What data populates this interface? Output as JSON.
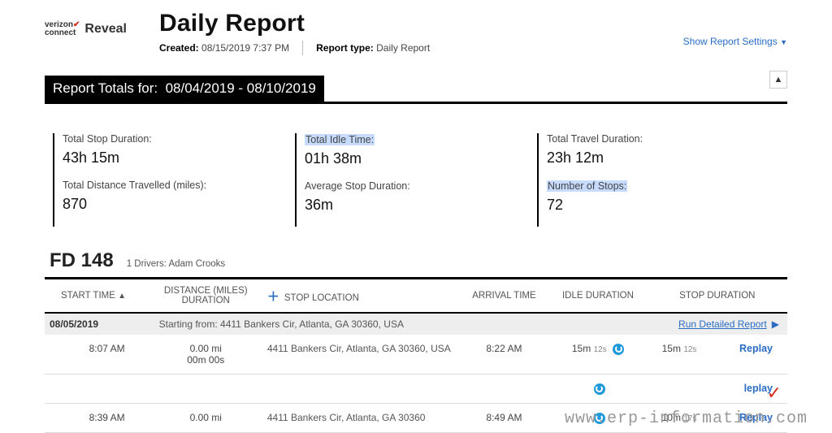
{
  "brand": {
    "line1": "verizon",
    "line2": "connect",
    "name": "Reveal"
  },
  "header": {
    "title": "Daily Report",
    "created_label": "Created:",
    "created_value": "08/15/2019 7:37 PM",
    "type_label": "Report type:",
    "type_value": "Daily Report",
    "settings_link": "Show Report Settings"
  },
  "totals": {
    "prefix": "Report Totals for:",
    "range": "08/04/2019 - 08/10/2019",
    "metrics": {
      "stop_dur_label": "Total Stop Duration:",
      "stop_dur_value": "43h 15m",
      "dist_label": "Total Distance Travelled (miles):",
      "dist_value": "870",
      "idle_label": "Total Idle Time:",
      "idle_value": "01h 38m",
      "avg_stop_label": "Average Stop Duration:",
      "avg_stop_value": "36m",
      "travel_label": "Total Travel Duration:",
      "travel_value": "23h 12m",
      "stops_label": "Number of Stops:",
      "stops_value": "72"
    }
  },
  "vehicle": {
    "name": "FD 148",
    "driver_label": "1 Drivers:",
    "driver_name": "Adam Crooks"
  },
  "columns": {
    "start": "START TIME",
    "dist": "DISTANCE (MILES)\nDURATION",
    "loc": "STOP LOCATION",
    "arrival": "ARRIVAL TIME",
    "idle": "IDLE DURATION",
    "stopdur": "STOP DURATION"
  },
  "day": {
    "date": "08/05/2019",
    "starting_label": "Starting from:",
    "starting_addr": "4411 Bankers Cir, Atlanta, GA 30360, USA",
    "detailed_link": "Run Detailed Report"
  },
  "rows": [
    {
      "start": "8:07 AM",
      "dist": "0.00 mi",
      "dur": "00m 00s",
      "loc": "4411 Bankers Cir, Atlanta, GA 30360, USA",
      "arrival": "8:22 AM",
      "idle_m": "15m",
      "idle_s": "12s",
      "stop_m": "15m",
      "stop_s": "12s",
      "replay": "Replay"
    },
    {
      "start": "",
      "dist": "",
      "dur": "",
      "loc": "",
      "arrival": "",
      "idle_m": "",
      "idle_s": "",
      "stop_m": "",
      "stop_s": "",
      "replay": "leplay"
    },
    {
      "start": "8:39 AM",
      "dist": "0.00 mi",
      "dur": "",
      "loc": "4411 Bankers Cir, Atlanta, GA 30360",
      "arrival": "8:49 AM",
      "idle_m": "",
      "idle_s": "",
      "stop_m": "10m",
      "stop_s": "17s",
      "replay": "Replay"
    }
  ],
  "watermark": "www.erp-information.com"
}
